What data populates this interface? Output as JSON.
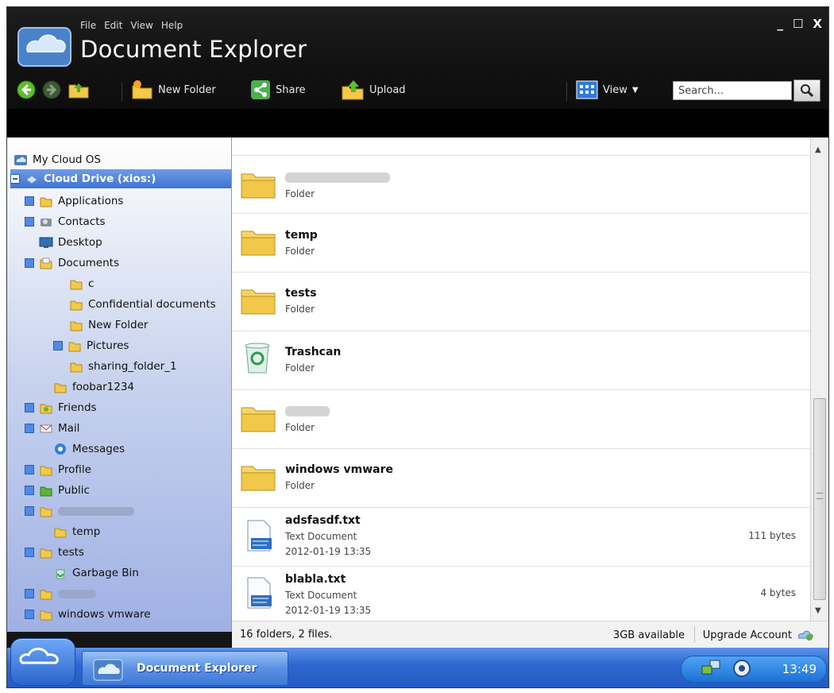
{
  "window": {
    "title": "Document Explorer",
    "menu": [
      "File",
      "Edit",
      "View",
      "Help"
    ],
    "controls": [
      "_",
      "☐",
      "X"
    ]
  },
  "toolbar": {
    "new_folder": "New Folder",
    "share": "Share",
    "upload": "Upload",
    "view": "View"
  },
  "search": {
    "placeholder": "Search..."
  },
  "sidebar": {
    "items": [
      {
        "label": "My Cloud OS",
        "icon": "cloud-icon"
      },
      {
        "label": "Cloud Drive (xios:)",
        "icon": "drive-icon"
      },
      {
        "label": "Applications",
        "icon": "folder-icon"
      },
      {
        "label": "Contacts",
        "icon": "contacts-icon"
      },
      {
        "label": "Desktop",
        "icon": "desktop-icon"
      },
      {
        "label": "Documents",
        "icon": "documents-icon"
      },
      {
        "label": "c",
        "icon": "folder-icon"
      },
      {
        "label": "Confidential documents",
        "icon": "folder-icon"
      },
      {
        "label": "New Folder",
        "icon": "folder-icon"
      },
      {
        "label": "Pictures",
        "icon": "folder-icon"
      },
      {
        "label": "sharing_folder_1",
        "icon": "folder-icon"
      },
      {
        "label": "foobar1234",
        "icon": "folder-icon"
      },
      {
        "label": "Friends",
        "icon": "friends-icon"
      },
      {
        "label": "Mail",
        "icon": "mail-icon"
      },
      {
        "label": "Messages",
        "icon": "messages-icon"
      },
      {
        "label": "Profile",
        "icon": "folder-icon"
      },
      {
        "label": "Public",
        "icon": "public-icon"
      },
      {
        "label": "",
        "icon": "folder-icon"
      },
      {
        "label": "temp",
        "icon": "folder-icon"
      },
      {
        "label": "tests",
        "icon": "folder-icon"
      },
      {
        "label": "Garbage Bin",
        "icon": "trash-icon"
      },
      {
        "label": "",
        "icon": "folder-icon"
      },
      {
        "label": "windows vmware",
        "icon": "folder-icon"
      }
    ]
  },
  "files": [
    {
      "name": "",
      "type": "Folder",
      "date": "",
      "size": "",
      "icon": "folder-icon"
    },
    {
      "name": "temp",
      "type": "Folder",
      "date": "",
      "size": "",
      "icon": "folder-icon"
    },
    {
      "name": "tests",
      "type": "Folder",
      "date": "",
      "size": "",
      "icon": "folder-icon"
    },
    {
      "name": "Trashcan",
      "type": "Folder",
      "date": "",
      "size": "",
      "icon": "trash-icon"
    },
    {
      "name": "",
      "type": "Folder",
      "date": "",
      "size": "",
      "icon": "folder-icon"
    },
    {
      "name": "windows vmware",
      "type": "Folder",
      "date": "",
      "size": "",
      "icon": "folder-icon"
    },
    {
      "name": "adsfasdf.txt",
      "type": "Text Document",
      "date": "2012-01-19 13:35",
      "size": "111 bytes",
      "icon": "text-document-icon"
    },
    {
      "name": "blabla.txt",
      "type": "Text Document",
      "date": "2012-01-19 13:35",
      "size": "4 bytes",
      "icon": "text-document-icon"
    }
  ],
  "status": {
    "summary": "16 folders, 2 files.",
    "available": "3GB available",
    "upgrade": "Upgrade Account"
  },
  "taskbar": {
    "task": "Document Explorer",
    "clock": "13:49"
  },
  "colors": {
    "accent": "#3f74d4",
    "taskbar": "#2d66cf",
    "titlebar": "#111111"
  }
}
